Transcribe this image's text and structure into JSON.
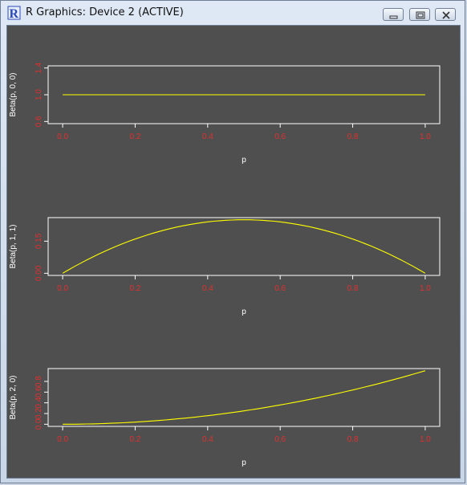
{
  "window": {
    "title": "R Graphics: Device 2 (ACTIVE)",
    "app_icon": "r-logo-icon",
    "buttons": [
      "minimize-icon",
      "restore-icon",
      "close-icon"
    ]
  },
  "colors": {
    "plot_background": "#4f4f4f",
    "line": "#ffff00",
    "tick_labels": "#e0302e",
    "axis_text": "#ffffff",
    "box": "#ffffff"
  },
  "chart_data": [
    {
      "type": "line",
      "xlabel": "p",
      "ylabel": "Beta(p, 0, 0)",
      "xlim": [
        0,
        1
      ],
      "ylim": [
        0.6,
        1.4
      ],
      "xticks": [
        "0.0",
        "0.2",
        "0.4",
        "0.6",
        "0.8",
        "1.0"
      ],
      "yticks": [
        "0.6",
        "1.0",
        "1.4"
      ],
      "x": [
        0.0,
        0.1,
        0.2,
        0.3,
        0.4,
        0.5,
        0.6,
        0.7,
        0.8,
        0.9,
        1.0
      ],
      "y": [
        1,
        1,
        1,
        1,
        1,
        1,
        1,
        1,
        1,
        1,
        1
      ]
    },
    {
      "type": "line",
      "xlabel": "p",
      "ylabel": "Beta(p, 1, 1)",
      "xlim": [
        0,
        1
      ],
      "ylim": [
        0,
        0.25
      ],
      "xticks": [
        "0.0",
        "0.2",
        "0.4",
        "0.6",
        "0.8",
        "1.0"
      ],
      "yticks": [
        "0.00",
        "0.15"
      ],
      "x": [
        0.0,
        0.1,
        0.2,
        0.3,
        0.4,
        0.5,
        0.6,
        0.7,
        0.8,
        0.9,
        1.0
      ],
      "y": [
        0.0,
        0.09,
        0.16,
        0.21,
        0.24,
        0.25,
        0.24,
        0.21,
        0.16,
        0.09,
        0.0
      ]
    },
    {
      "type": "line",
      "xlabel": "p",
      "ylabel": "Beta(p, 2, 0)",
      "xlim": [
        0,
        1
      ],
      "ylim": [
        0,
        1
      ],
      "xticks": [
        "0.0",
        "0.2",
        "0.4",
        "0.6",
        "0.8",
        "1.0"
      ],
      "yticks": [
        "0.0",
        "0.2",
        "0.4",
        "0.6",
        "0.8"
      ],
      "x": [
        0.0,
        0.1,
        0.2,
        0.3,
        0.4,
        0.5,
        0.6,
        0.7,
        0.8,
        0.9,
        1.0
      ],
      "y": [
        0.0,
        0.01,
        0.04,
        0.09,
        0.16,
        0.25,
        0.36,
        0.49,
        0.64,
        0.81,
        1.0
      ]
    }
  ]
}
